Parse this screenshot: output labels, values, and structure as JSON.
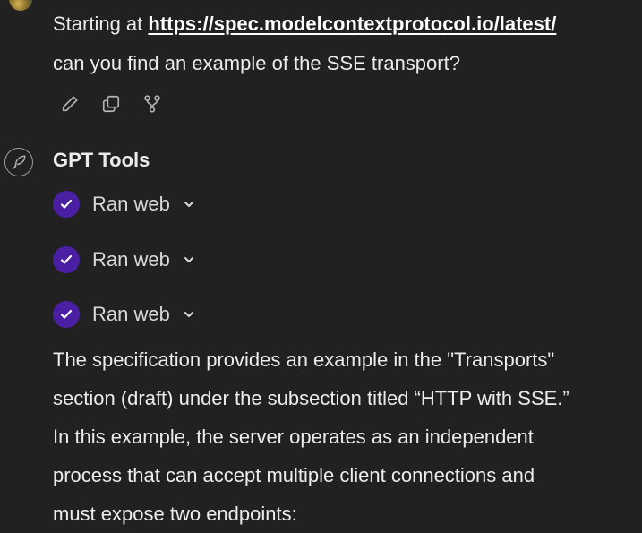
{
  "user_message": {
    "prefix": "Starting at ",
    "link": "https://spec.modelcontextprotocol.io/latest/",
    "line2": "can you find an example of the SSE transport?"
  },
  "message_actions": [
    {
      "icon": "pencil-icon"
    },
    {
      "icon": "copy-icon"
    },
    {
      "icon": "branch-icon"
    }
  ],
  "assistant": {
    "name": "GPT Tools",
    "avatar_icon": "feather-pen-icon",
    "tool_calls": [
      {
        "label": "Ran web"
      },
      {
        "label": "Ran web"
      },
      {
        "label": "Ran web"
      }
    ],
    "response_lines": [
      "The specification provides an example in the \"Transports\"",
      "section (draft) under the subsection titled “HTTP with SSE.”",
      "In this example, the server operates as an independent",
      "process that can accept multiple client connections and",
      "must expose two endpoints:"
    ]
  },
  "colors": {
    "background": "#212121",
    "text": "#ececec",
    "check_badge": "#4b1fa3"
  }
}
